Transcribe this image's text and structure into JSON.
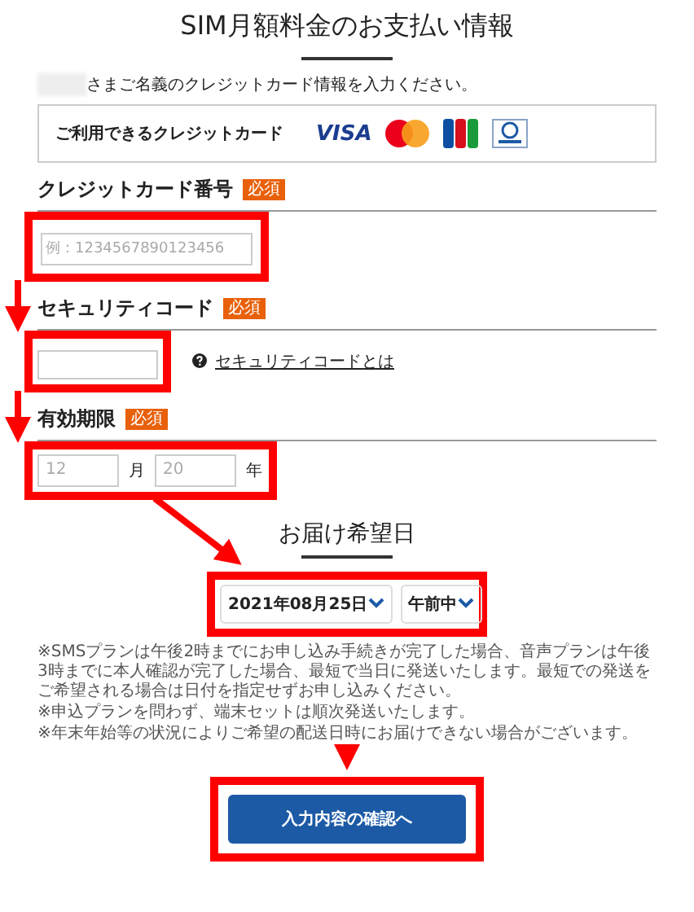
{
  "page_title": "SIM月額料金のお支払い情報",
  "intro": "さまご名義のクレジットカード情報を入力ください。",
  "accepted_cards": {
    "label": "ご利用できるクレジットカード",
    "brands": [
      {
        "kind": "visa",
        "text": "VISA"
      },
      {
        "kind": "mastercard"
      },
      {
        "kind": "jcb"
      },
      {
        "kind": "diners"
      }
    ]
  },
  "fields": [
    {
      "kind": "card_number",
      "label": "クレジットカード番号",
      "badge": "必須",
      "placeholder": "例：1234567890123456"
    },
    {
      "kind": "security_code",
      "label": "セキュリティコード",
      "badge": "必須",
      "link": "セキュリティコードとは"
    },
    {
      "kind": "expiry",
      "label": "有効期限",
      "badge": "必須",
      "inputs": [
        {
          "placeholder": "12",
          "unit": "月"
        },
        {
          "placeholder": "20",
          "unit": "年"
        }
      ]
    }
  ],
  "delivery": {
    "title": "お届け希望日",
    "date": "2021年08月25日",
    "time": "午前中"
  },
  "notes": [
    "※SMSプランは午後2時までにお申し込み手続きが完了した場合、音声プランは午後3時までに本人確認が完了した場合、最短で当日に発送いたします。最短での発送をご希望される場合は日付を指定せずお申し込みください。",
    "※申込プランを問わず、端末セットは順次発送いたします。",
    "※年末年始等の状況によりご希望の配送日時にお届けできない場合がございます。"
  ],
  "confirm_button": "入力内容の確認へ"
}
